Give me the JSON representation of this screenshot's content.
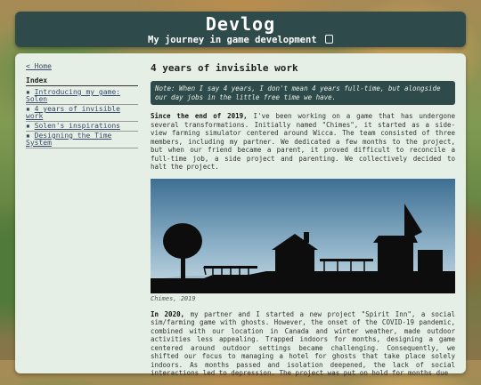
{
  "header": {
    "title": "Devlog",
    "subtitle": "My journey in game development"
  },
  "sidebar": {
    "home_link": "< Home",
    "index_title": "Index",
    "items": [
      {
        "label": "Introducing my game: Solen"
      },
      {
        "label": "4 years of invisible work"
      },
      {
        "label": "Solen's inspirations"
      },
      {
        "label": "Designing the Time System"
      }
    ]
  },
  "post": {
    "title": "4 years of invisible work",
    "note": "Note: When I say 4 years, I don't mean 4 years full-time, but alongside our day jobs in the little free time we have.",
    "para1_lead": "Since the end of 2019,",
    "para1_body": " I've been working on a game that has undergone several transformations. Initially named \"Chimes\", it started as a side-view farming simulator centered around Wicca. The team consisted of three members, including my partner. We dedicated a few months to the project, but when our friend became a parent, it proved difficult to reconcile a full-time job, a side project and parenting. We collectively decided to halt the project.",
    "figure_caption": "Chimes, 2019",
    "para2_lead": "In 2020,",
    "para2_body": " my partner and I started a new project \"Spirit Inn\", a social sim/farming game with ghosts. However, the onset of the COVID-19 pandemic, combined with our location in Canada and winter weather, made outdoor activities less appealing. Trapped indoors for months, designing a game centered around outdoor settings became challenging. Consequently, we shifted our focus to managing a hotel for ghosts that take place solely indoors. As months passed and isolation deepened, the lack of social interactions led to depression. The project was put on hold for months due"
  },
  "colors": {
    "header_bg": "#2f4a4a",
    "panel_bg": "#e6efe6",
    "link": "#3a4a6a"
  },
  "icons": {
    "subtitle_icon": "github-icon"
  }
}
